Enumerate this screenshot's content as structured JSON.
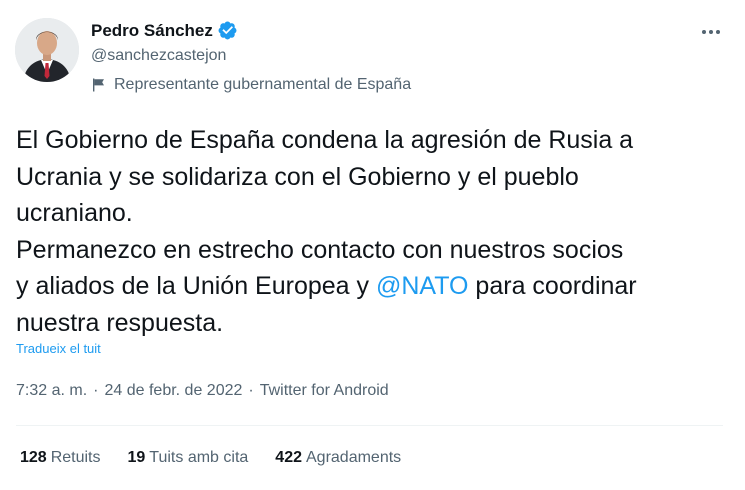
{
  "author": {
    "display_name": "Pedro Sánchez",
    "handle": "@sanchezcastejon",
    "label": "Representante gubernamental de España",
    "verified_icon": "verified-badge-icon",
    "avatar_icon": "avatar"
  },
  "menu": {
    "icon": "more-horizontal-icon"
  },
  "tweet": {
    "lines": [
      "El Gobierno de España condena la agresión de Rusia a",
      "Ucrania y se solidariza con el Gobierno y el pueblo",
      "ucraniano.",
      "Permanezco en estrecho contacto con nuestros socios"
    ],
    "line5_before": "y aliados de la Unión Europea y ",
    "mention": "@NATO",
    "line5_after": " para coordinar",
    "line6": "nuestra respuesta."
  },
  "translate_link": "Tradueix el tuit",
  "meta": {
    "time": "7:32 a. m.",
    "separator": "·",
    "date": "24 de febr. de 2022",
    "source": "Twitter for Android"
  },
  "stats": [
    {
      "count": "128",
      "label": "Retuits"
    },
    {
      "count": "19",
      "label": "Tuits amb cita"
    },
    {
      "count": "422",
      "label": "Agradaments"
    }
  ],
  "colors": {
    "accent": "#1d9bf0",
    "text": "#0f1419",
    "secondary": "#536471",
    "divider": "#eff3f4"
  }
}
